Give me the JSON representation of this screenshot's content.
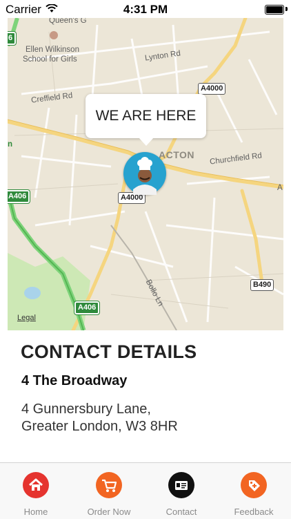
{
  "status_bar": {
    "carrier": "Carrier",
    "time": "4:31 PM"
  },
  "map": {
    "bubble_text": "WE ARE HERE",
    "labels": {
      "queens": "Queen's G",
      "school_1": "Ellen Wilkinson",
      "school_2": "School for Girls",
      "lynton": "Lynton Rd",
      "creffield": "Creffield Rd",
      "acton": "ACTON",
      "churchfield": "Churchfield Rd",
      "bollo": "Bollo Ln",
      "n_letter": "n",
      "a_letter": "A",
      "legal": "Legal"
    },
    "badges": {
      "a4000_top": "A4000",
      "a4000_mid": "A4000",
      "a406_left": "A406",
      "a406_bottom": "A406",
      "b490": "B490",
      "green_top": "6"
    }
  },
  "contact": {
    "title": "CONTACT DETAILS",
    "place_name": "4 The Broadway",
    "address_line1": "4 Gunnersbury Lane,",
    "address_line2": "Greater London, W3 8HR"
  },
  "tabs": [
    {
      "label": "Home",
      "color": "#e5342f",
      "icon": "home-icon"
    },
    {
      "label": "Order Now",
      "color": "#f26522",
      "icon": "cart-icon"
    },
    {
      "label": "Contact",
      "color": "#111111",
      "icon": "contact-card-icon"
    },
    {
      "label": "Feedback",
      "color": "#f26522",
      "icon": "tag-plus-icon"
    }
  ]
}
